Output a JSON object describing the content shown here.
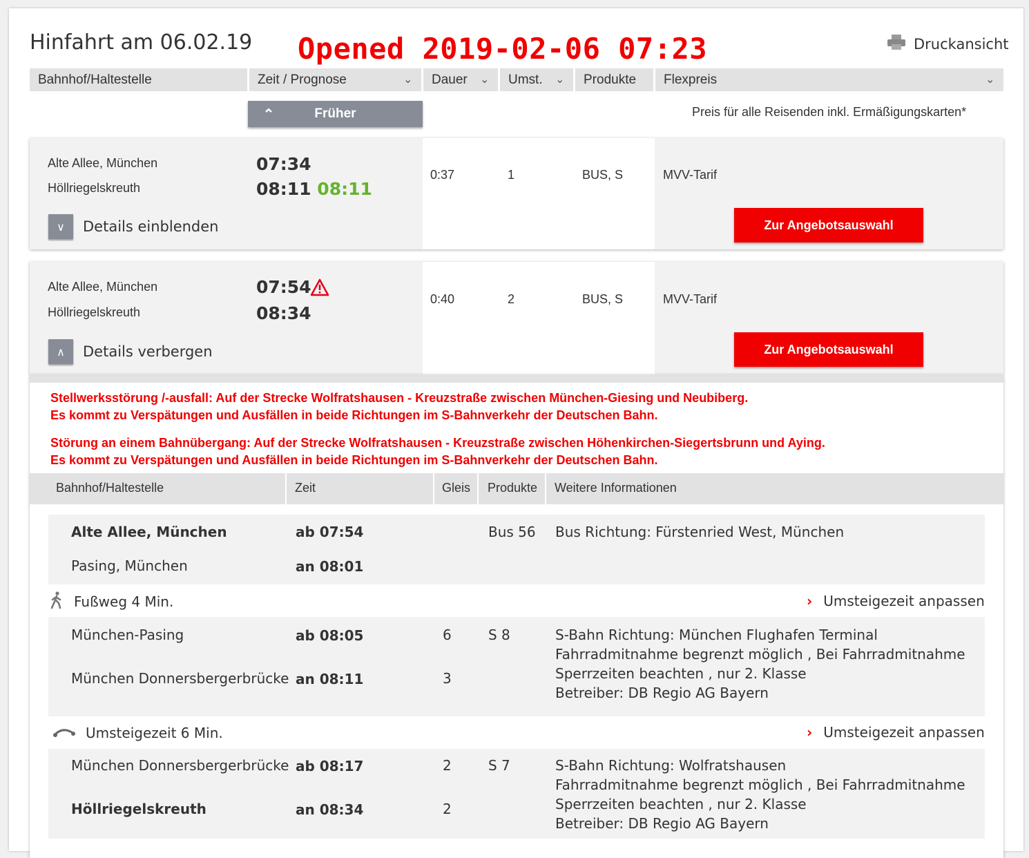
{
  "header": {
    "title": "Hinfahrt am 06.02.19",
    "opened_stamp": "Opened 2019-02-06 07:23",
    "print_label": "Druckansicht"
  },
  "columns": {
    "station": "Bahnhof/Haltestelle",
    "time": "Zeit / Prognose",
    "duration": "Dauer",
    "changes": "Umst.",
    "products": "Produkte",
    "fare": "Flexpreis"
  },
  "earlier_label": "Früher",
  "price_note": "Preis für alle Reisenden inkl. Ermäßigungskarten*",
  "connections": [
    {
      "from": "Alte Allee, München",
      "to": "Höllriegelskreuth",
      "dep": "07:34",
      "arr": "08:11",
      "arr_prognosis": "08:11",
      "duration": "0:37",
      "changes": "1",
      "products": "BUS, S",
      "fare": "MVV-Tarif",
      "details_label": "Details einblenden",
      "offer_label": "Zur Angebotsauswahl"
    },
    {
      "from": "Alte Allee, München",
      "to": "Höllriegelskreuth",
      "dep": "07:54",
      "arr": "08:34",
      "duration": "0:40",
      "changes": "2",
      "products": "BUS, S",
      "fare": "MVV-Tarif",
      "details_label": "Details verbergen",
      "offer_label": "Zur Angebotsauswahl"
    }
  ],
  "notices": [
    "Stellwerksstörung /-ausfall: Auf der Strecke Wolfratshausen - Kreuzstraße zwischen München-Giesing und Neubiberg.",
    "Es kommt zu Verspätungen und Ausfällen in beide Richtungen im S-Bahnverkehr der Deutschen Bahn.",
    "Störung an einem Bahnübergang: Auf der Strecke Wolfratshausen - Kreuzstraße zwischen Höhenkirchen-Siegertsbrunn und Aying.",
    "Es kommt zu Verspätungen und Ausfällen in beide Richtungen im S-Bahnverkehr der Deutschen Bahn."
  ],
  "detail_columns": {
    "station": "Bahnhof/Haltestelle",
    "time": "Zeit",
    "track": "Gleis",
    "products": "Produkte",
    "info": "Weitere Informationen"
  },
  "segments": [
    {
      "dep_station": "Alte Allee, München",
      "dep_time": "ab 07:54",
      "arr_station": "Pasing, München",
      "arr_time": "an 08:01",
      "product": "Bus 56",
      "info": [
        "Bus Richtung: Fürstenried West, München"
      ]
    },
    {
      "dep_station": "München-Pasing",
      "dep_time": "ab 08:05",
      "dep_track": "6",
      "arr_station": "München Donnersbergerbrücke",
      "arr_time": "an 08:11",
      "arr_track": "3",
      "product": "S 8",
      "info": [
        "S-Bahn Richtung: München Flughafen Terminal",
        "Fahrradmitnahme begrenzt möglich , Bei Fahrradmitnahme",
        "Sperrzeiten beachten , nur 2. Klasse",
        "Betreiber: DB Regio AG Bayern"
      ]
    },
    {
      "dep_station": "München Donnersbergerbrücke",
      "dep_time": "ab 08:17",
      "dep_track": "2",
      "arr_station": "Höllriegelskreuth",
      "arr_time": "an 08:34",
      "arr_track": "2",
      "product": "S 7",
      "info": [
        "S-Bahn Richtung: Wolfratshausen",
        "Fahrradmitnahme begrenzt möglich , Bei Fahrradmitnahme",
        "Sperrzeiten beachten , nur 2. Klasse",
        "Betreiber: DB Regio AG Bayern"
      ]
    }
  ],
  "transfers": [
    {
      "label": "Fußweg 4 Min.",
      "icon": "walk-icon",
      "adjust_label": "Umsteigezeit anpassen"
    },
    {
      "label": "Umsteigezeit 6 Min.",
      "icon": "transfer-icon",
      "adjust_label": "Umsteigezeit anpassen"
    }
  ],
  "colors": {
    "accent_red": "#f00000",
    "on_time_green": "#65b32e",
    "button_grey": "#878c96"
  }
}
